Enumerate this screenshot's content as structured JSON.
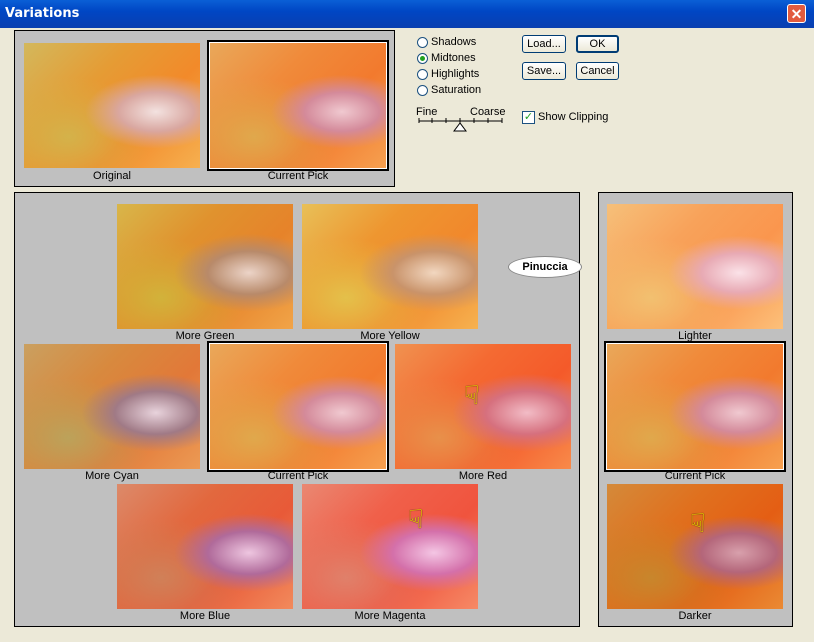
{
  "window": {
    "title": "Variations",
    "close_glyph": "✕"
  },
  "top": {
    "original_label": "Original",
    "current_label": "Current Pick"
  },
  "radios": [
    {
      "label": "Shadows",
      "checked": false
    },
    {
      "label": "Midtones",
      "checked": true
    },
    {
      "label": "Highlights",
      "checked": false
    },
    {
      "label": "Saturation",
      "checked": false
    }
  ],
  "slider": {
    "fine": "Fine",
    "coarse": "Coarse"
  },
  "buttons": {
    "load": "Load...",
    "ok": "OK",
    "save": "Save...",
    "cancel": "Cancel"
  },
  "show_clipping": {
    "label": "Show Clipping",
    "checked": true
  },
  "variations": {
    "more_green": "More Green",
    "more_yellow": "More Yellow",
    "more_cyan": "More Cyan",
    "current_pick": "Current Pick",
    "more_red": "More Red",
    "more_blue": "More Blue",
    "more_magenta": "More Magenta"
  },
  "brightness": {
    "lighter": "Lighter",
    "current_pick": "Current Pick",
    "darker": "Darker"
  },
  "watermark": "Pinuccia"
}
